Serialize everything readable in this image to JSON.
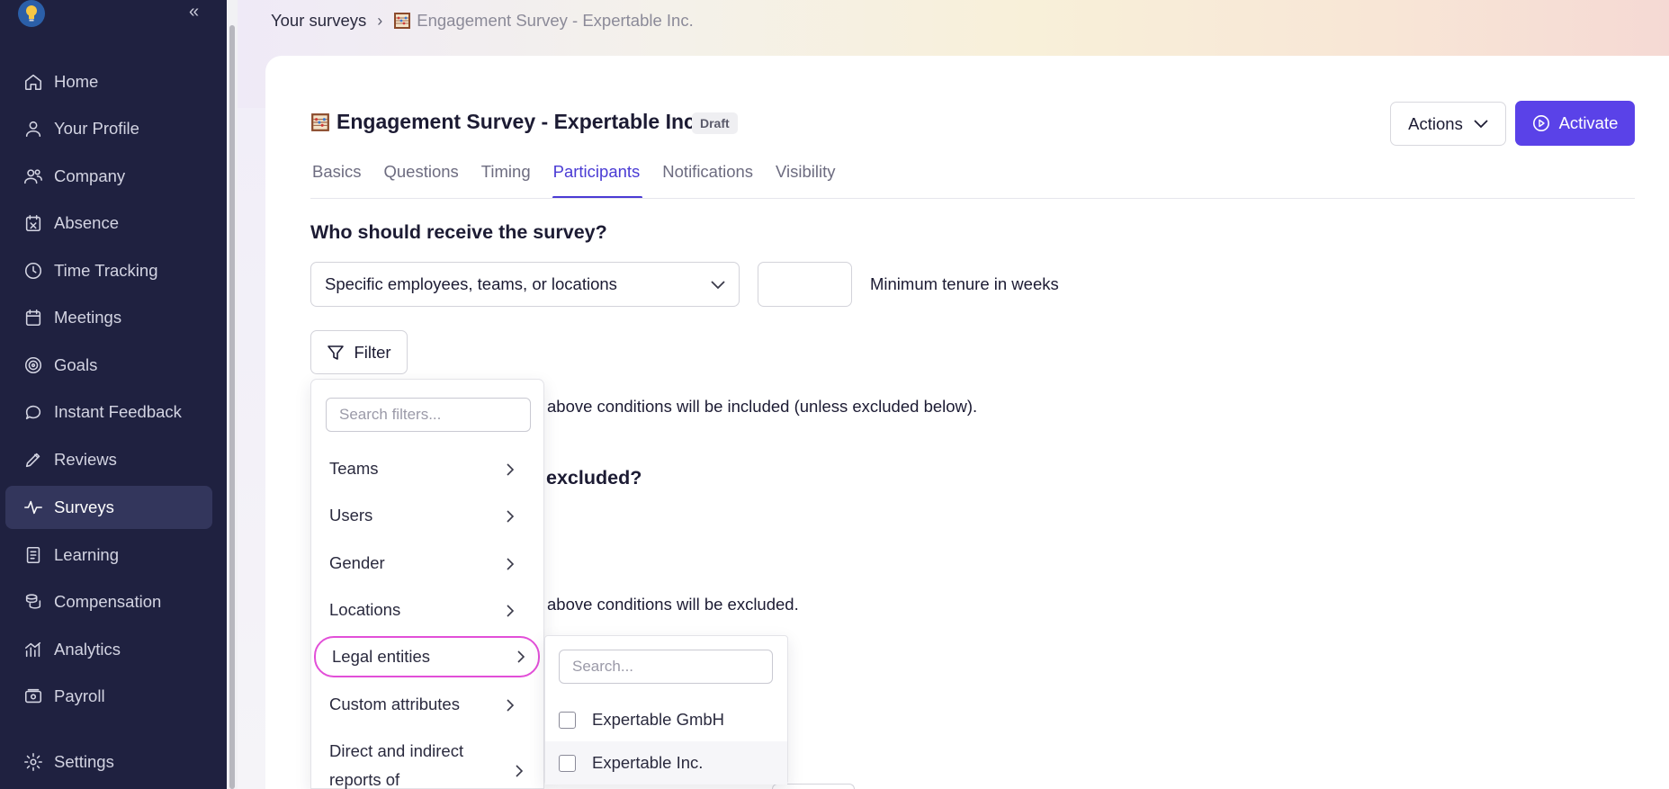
{
  "sidebar": {
    "items": [
      {
        "label": "Home",
        "icon": "home-icon"
      },
      {
        "label": "Your Profile",
        "icon": "user-icon"
      },
      {
        "label": "Company",
        "icon": "users-icon"
      },
      {
        "label": "Absence",
        "icon": "calendar-x-icon"
      },
      {
        "label": "Time Tracking",
        "icon": "clock-icon"
      },
      {
        "label": "Meetings",
        "icon": "calendar-icon"
      },
      {
        "label": "Goals",
        "icon": "target-icon"
      },
      {
        "label": "Instant Feedback",
        "icon": "chat-bubble-icon"
      },
      {
        "label": "Reviews",
        "icon": "pencil-icon"
      },
      {
        "label": "Surveys",
        "icon": "activity-icon"
      },
      {
        "label": "Learning",
        "icon": "book-icon"
      },
      {
        "label": "Compensation",
        "icon": "coins-icon"
      },
      {
        "label": "Analytics",
        "icon": "bar-chart-icon"
      },
      {
        "label": "Payroll",
        "icon": "wallet-icon"
      }
    ],
    "active": "Surveys",
    "settings_label": "Settings"
  },
  "breadcrumb": {
    "root": "Your surveys",
    "current": "Engagement Survey - Expertable Inc."
  },
  "header": {
    "title": "Engagement Survey - Expertable Inc.",
    "status": "Draft",
    "actions_label": "Actions",
    "activate_label": "Activate"
  },
  "tabs": [
    {
      "label": "Basics",
      "active": false
    },
    {
      "label": "Questions",
      "active": false
    },
    {
      "label": "Timing",
      "active": false
    },
    {
      "label": "Participants",
      "active": true
    },
    {
      "label": "Notifications",
      "active": false
    },
    {
      "label": "Visibility",
      "active": false
    }
  ],
  "participants": {
    "receive_heading": "Who should receive the survey?",
    "recipient_select": "Specific employees, teams, or locations",
    "tenure_value": "",
    "tenure_label": "Minimum tenure in weeks",
    "filter_label": "Filter",
    "include_note": "above conditions will be included (unless excluded below).",
    "exclude_heading": "excluded?",
    "exclude_note": "above conditions will be excluded."
  },
  "filter_menu": {
    "search_placeholder": "Search filters...",
    "items": [
      {
        "label": "Teams"
      },
      {
        "label": "Users"
      },
      {
        "label": "Gender"
      },
      {
        "label": "Locations"
      },
      {
        "label": "Legal entities"
      },
      {
        "label": "Custom attributes"
      },
      {
        "label": "Direct and indirect reports of"
      }
    ],
    "highlighted": "Legal entities"
  },
  "legal_entities": {
    "search_placeholder": "Search...",
    "options": [
      {
        "label": "Expertable GmbH",
        "checked": false
      },
      {
        "label": "Expertable Inc.",
        "checked": false
      }
    ]
  },
  "colors": {
    "sidebar_bg": "#1f2140",
    "accent": "#5a42e8",
    "highlight_ring": "#e24fd8"
  }
}
